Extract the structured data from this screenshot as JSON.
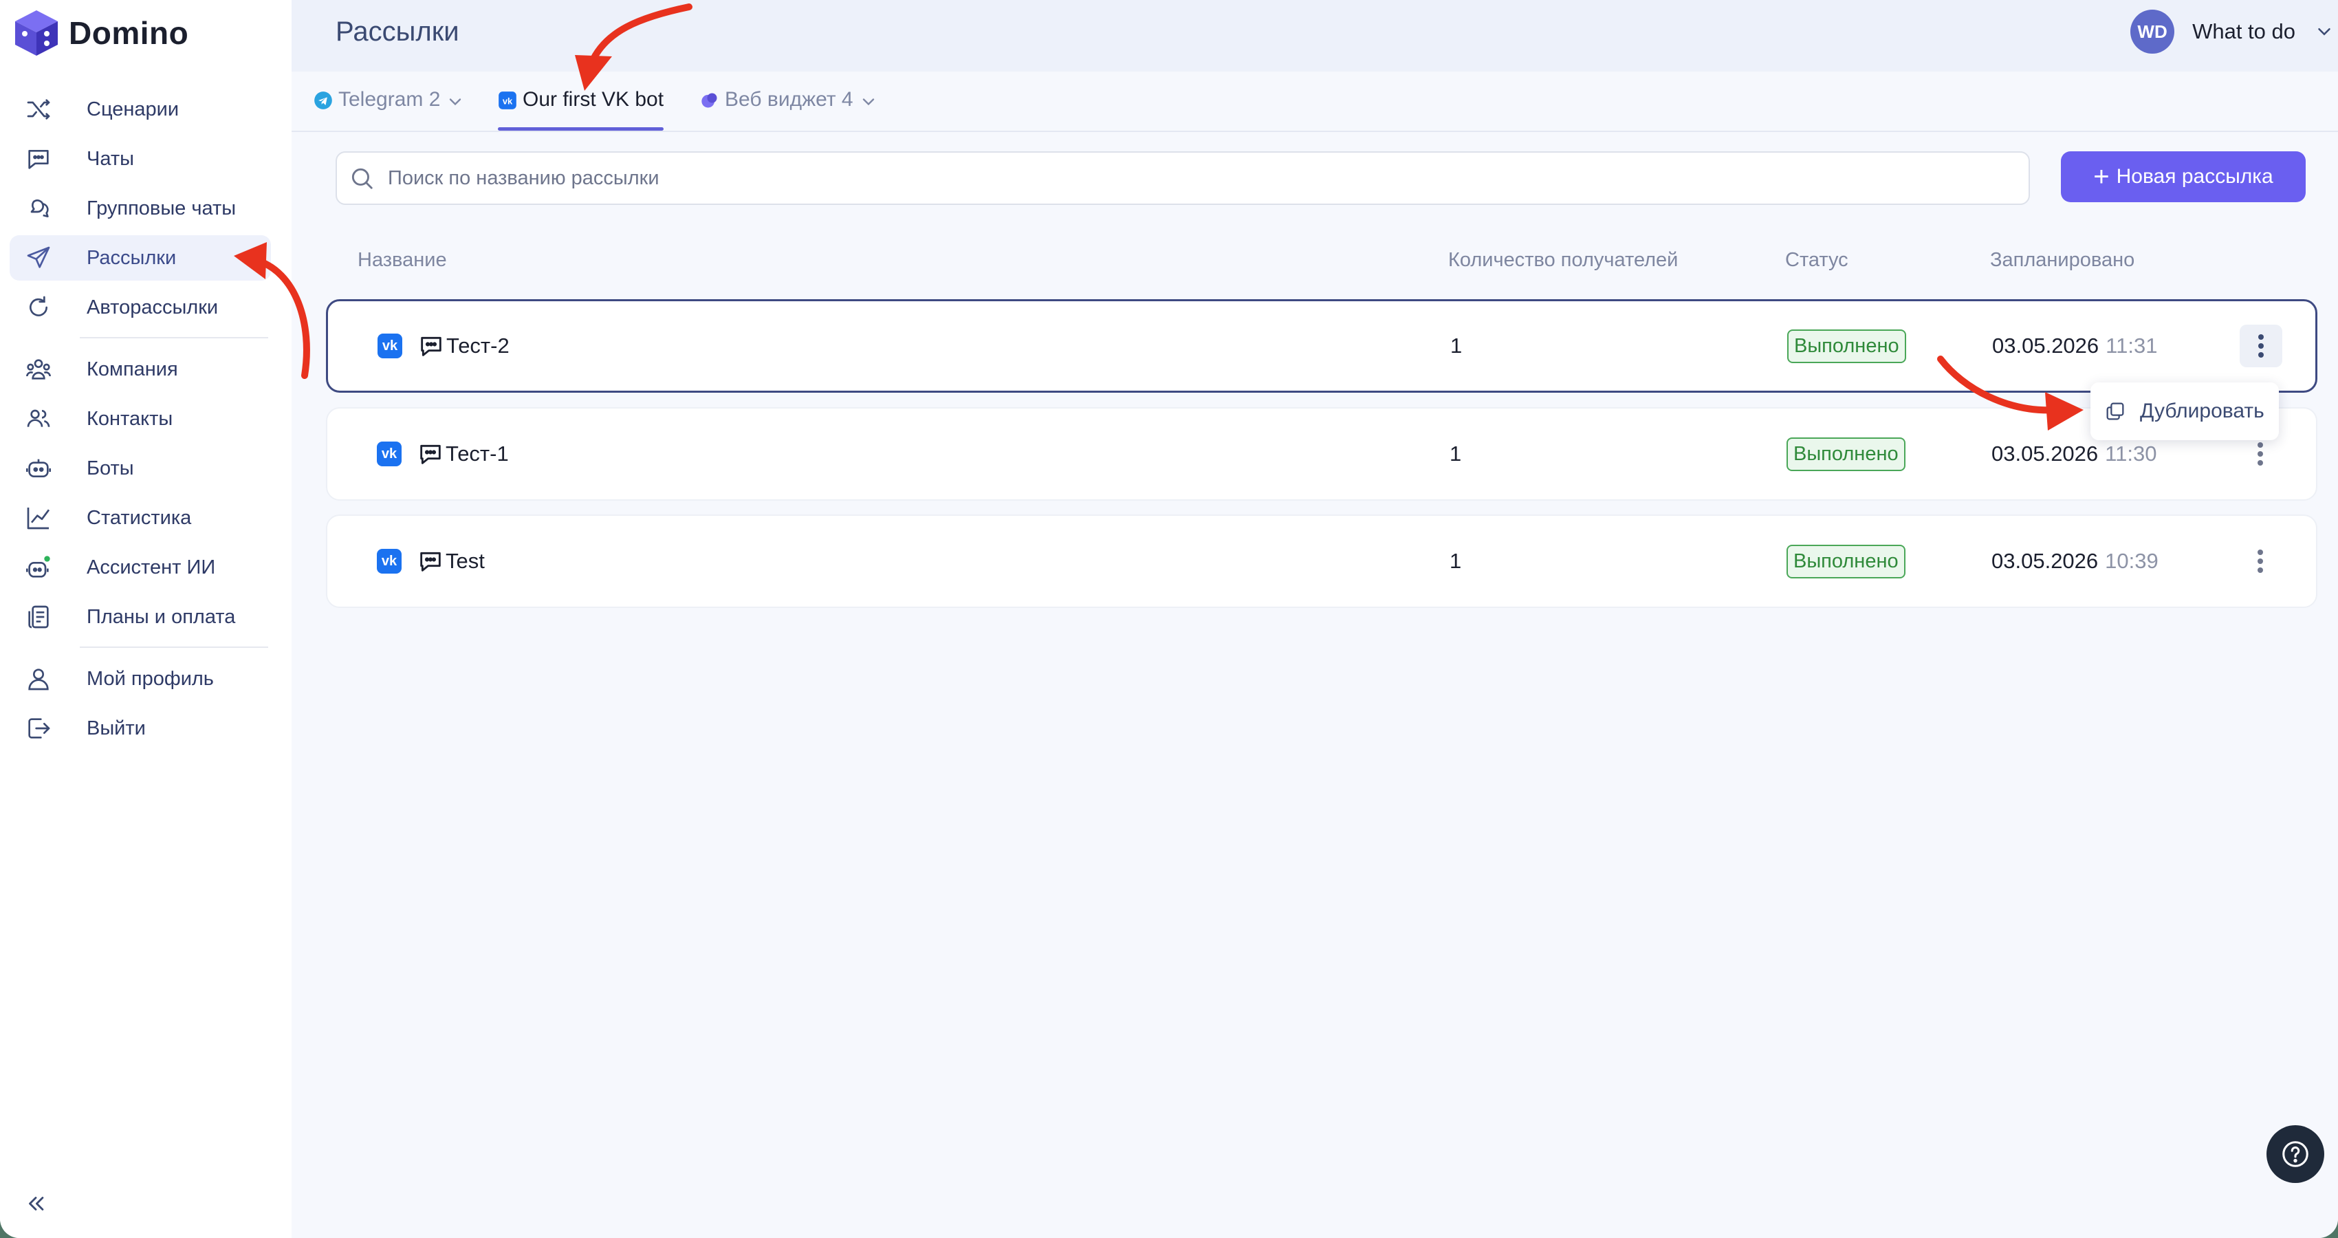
{
  "app": {
    "name": "Domino"
  },
  "sidebar": {
    "items": [
      {
        "label": "Сценарии",
        "icon": "shuffle-icon"
      },
      {
        "label": "Чаты",
        "icon": "chat-icon"
      },
      {
        "label": "Групповые чаты",
        "icon": "group-chats-icon"
      },
      {
        "label": "Рассылки",
        "icon": "send-icon",
        "active": true
      },
      {
        "label": "Авторассылки",
        "icon": "autosend-icon"
      },
      {
        "label": "Компания",
        "icon": "company-icon"
      },
      {
        "label": "Контакты",
        "icon": "contacts-icon"
      },
      {
        "label": "Боты",
        "icon": "bot-icon"
      },
      {
        "label": "Статистика",
        "icon": "stats-icon"
      },
      {
        "label": "Ассистент ИИ",
        "icon": "ai-assistant-icon"
      },
      {
        "label": "Планы и оплата",
        "icon": "billing-icon"
      },
      {
        "label": "Мой профиль",
        "icon": "profile-icon"
      },
      {
        "label": "Выйти",
        "icon": "logout-icon"
      }
    ]
  },
  "header": {
    "title": "Рассылки",
    "user": {
      "initials": "WD",
      "name": "What to do"
    }
  },
  "tabs": [
    {
      "label": "Telegram 2",
      "icon": "telegram-icon"
    },
    {
      "label": "Our first VK bot",
      "icon": "vk-icon",
      "active": true
    },
    {
      "label": "Веб виджет 4",
      "icon": "web-widget-icon"
    }
  ],
  "search": {
    "placeholder": "Поиск по названию рассылки",
    "value": ""
  },
  "new_button": {
    "label": "Новая рассылка"
  },
  "table": {
    "columns": [
      "Название",
      "Количество получателей",
      "Статус",
      "Запланировано"
    ],
    "rows": [
      {
        "name": "Тест-2",
        "recipients": "1",
        "status": "Выполнено",
        "date": "03.05.2026",
        "time": "11:31"
      },
      {
        "name": "Тест-1",
        "recipients": "1",
        "status": "Выполнено",
        "date": "03.05.2026",
        "time": "11:30"
      },
      {
        "name": "Test",
        "recipients": "1",
        "status": "Выполнено",
        "date": "03.05.2026",
        "time": "10:39"
      }
    ]
  },
  "context_menu": {
    "items": [
      {
        "label": "Дублировать",
        "icon": "duplicate-icon"
      }
    ]
  },
  "colors": {
    "accent": "#6a5ff0",
    "success": "#2f8a3a",
    "vk": "#1b72f0",
    "annotation": "#e8321e"
  }
}
